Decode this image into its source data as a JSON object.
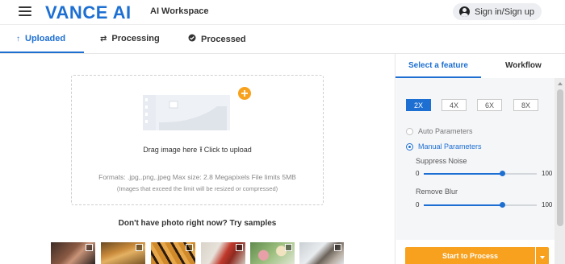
{
  "header": {
    "logo": "VANCE AI",
    "workspace_label": "AI Workspace",
    "signin_label": "Sign in/Sign up"
  },
  "tabs": [
    {
      "label": "Uploaded",
      "icon": "upload-arrow-icon",
      "active": true
    },
    {
      "label": "Processing",
      "icon": "refresh-icon",
      "active": false
    },
    {
      "label": "Processed",
      "icon": "check-circle-icon",
      "active": false
    }
  ],
  "upload": {
    "drag_text": "Drag image here",
    "click_text": "Click to upload",
    "formats_text": "Formats: .jpg,.png,.jpeg Max size: 2.8 Megapixels File limits 5MB",
    "limit_note": "(Images that exceed the limit will be resized or compressed)",
    "add_icon": "plus-circle-icon"
  },
  "samples": {
    "title": "Don't have photo right now? Try samples",
    "items": [
      {
        "name": "woman-portrait"
      },
      {
        "name": "dog-costume"
      },
      {
        "name": "tiger"
      },
      {
        "name": "woman-red-dress"
      },
      {
        "name": "flowers-bouquet"
      },
      {
        "name": "cat"
      }
    ]
  },
  "panel": {
    "tabs": [
      {
        "label": "Select a feature",
        "active": true
      },
      {
        "label": "Workflow",
        "active": false
      }
    ],
    "scales": [
      {
        "label": "2X",
        "active": true
      },
      {
        "label": "4X",
        "active": false
      },
      {
        "label": "6X",
        "active": false
      },
      {
        "label": "8X",
        "active": false
      }
    ],
    "modes": [
      {
        "label": "Auto Parameters",
        "selected": false
      },
      {
        "label": "Manual Parameters",
        "selected": true
      }
    ],
    "sliders": [
      {
        "label": "Suppress Noise",
        "min": "0",
        "max": "100",
        "value": 69
      },
      {
        "label": "Remove Blur",
        "min": "0",
        "max": "100",
        "value": 69
      }
    ],
    "start_label": "Start to Process"
  },
  "colors": {
    "accent": "#1d6fd2",
    "cta": "#f7a11e"
  }
}
